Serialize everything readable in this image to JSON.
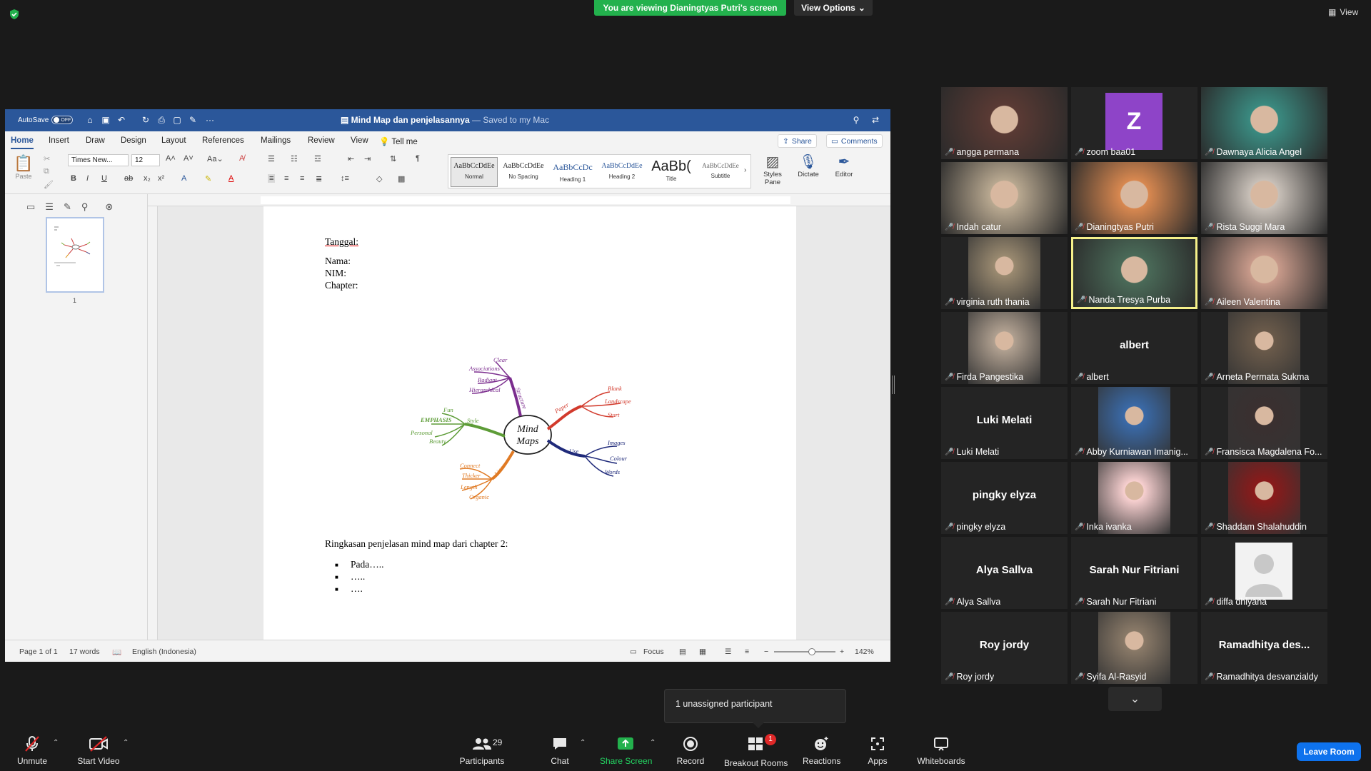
{
  "topbar": {
    "banner": "You are viewing Dianingtyas Putri's screen",
    "view_options": "View Options",
    "view": "View"
  },
  "word": {
    "autosave_label": "AutoSave",
    "autosave_state": "OFF",
    "doc_title": "Mind Map dan penjelasannya",
    "saved_status": "— Saved to my Mac",
    "tabs": [
      "Home",
      "Insert",
      "Draw",
      "Design",
      "Layout",
      "References",
      "Mailings",
      "Review",
      "View"
    ],
    "tell_me": "Tell me",
    "share": "Share",
    "comments": "Comments",
    "paste": "Paste",
    "font_name": "Times New...",
    "font_size": "12",
    "styles": [
      {
        "sample": "AaBbCcDdEe",
        "label": "Normal"
      },
      {
        "sample": "AaBbCcDdEe",
        "label": "No Spacing"
      },
      {
        "sample": "AaBbCcDc",
        "label": "Heading 1"
      },
      {
        "sample": "AaBbCcDdEe",
        "label": "Heading 2"
      },
      {
        "sample": "AaBb(",
        "label": "Title"
      },
      {
        "sample": "AaBbCcDdEe",
        "label": "Subtitle"
      }
    ],
    "styles_pane": "Styles Pane",
    "dictate": "Dictate",
    "editor": "Editor",
    "thumb_page": "1",
    "document": {
      "tanggal": "Tanggal:",
      "nama": "Nama:",
      "nim": "NIM:",
      "chapter": "Chapter:",
      "ringkasan": "Ringkasan penjelasan mind map dari chapter 2:",
      "bullets": [
        "Pada…..",
        "…..",
        "…."
      ],
      "mindmap": {
        "center": [
          "Mind",
          "Maps"
        ],
        "labels": [
          "Clear",
          "Associations",
          "Radiant",
          "Hierarchical",
          "Structure",
          "Paper",
          "Blank",
          "Landscape",
          "Start",
          "Use",
          "Images",
          "Colour",
          "Words",
          "Lines",
          "Connect",
          "Thicker",
          "Length",
          "Organic",
          "Style",
          "Fun",
          "EMPHASIS",
          "Personal",
          "Beauty"
        ]
      }
    },
    "status": {
      "page": "Page 1 of 1",
      "words": "17 words",
      "language": "English (Indonesia)",
      "focus": "Focus",
      "zoom": "142%"
    }
  },
  "participants": [
    {
      "name": "angga permana",
      "display": "video",
      "color": "#5a3a34"
    },
    {
      "name": "zoom baa01",
      "display": "letter",
      "letter": "Z",
      "color": "#8e44c8"
    },
    {
      "name": "Dawnaya Alicia Angel",
      "display": "video",
      "color": "#3a8a80"
    },
    {
      "name": "Indah catur",
      "display": "video",
      "color": "#b8a890"
    },
    {
      "name": "Dianingtyas Putri",
      "display": "video",
      "color": "#d88850"
    },
    {
      "name": "Rista Suggi Mara",
      "display": "video",
      "color": "#c8c0b8"
    },
    {
      "name": "virginia ruth thania",
      "display": "photo",
      "color": "#9a8a70"
    },
    {
      "name": "Nanda Tresya Purba",
      "display": "video",
      "color": "#4a6a58",
      "active": true
    },
    {
      "name": "Aileen Valentina",
      "display": "video",
      "color": "#c89a8a"
    },
    {
      "name": "Firda Pangestika",
      "display": "photo",
      "color": "#b0a090"
    },
    {
      "name": "albert",
      "display": "text"
    },
    {
      "name": "Arneta Permata Sukma",
      "display": "photo",
      "color": "#6a5a4a"
    },
    {
      "name": "Luki Melati",
      "display": "text"
    },
    {
      "name": "Abby Kurniawan Imanig...",
      "display": "photo",
      "color": "#3a6aa8"
    },
    {
      "name": "Fransisca Magdalena Fo...",
      "display": "photo",
      "color": "#3a3030"
    },
    {
      "name": "pingky elyza",
      "display": "text"
    },
    {
      "name": "Inka ivanka",
      "display": "photo",
      "color": "#f8d0d0"
    },
    {
      "name": "Shaddam Shalahuddin",
      "display": "photo",
      "color": "#8a1a1a"
    },
    {
      "name": "Alya Sallva",
      "display": "text"
    },
    {
      "name": "Sarah Nur Fitriani",
      "display": "text"
    },
    {
      "name": "diffa dhiyana",
      "display": "avatar"
    },
    {
      "name": "Roy jordy",
      "display": "text"
    },
    {
      "name": "Syifa Al-Rasyid",
      "display": "photo",
      "color": "#8a7a68"
    },
    {
      "name": "Ramadhitya desvanzialdy",
      "display": "text",
      "center": "Ramadhitya  des..."
    }
  ],
  "popup": {
    "unassigned": "1 unassigned participant"
  },
  "toolbar": {
    "unmute": "Unmute",
    "start_video": "Start Video",
    "participants": "Participants",
    "participants_count": "29",
    "chat": "Chat",
    "share_screen": "Share Screen",
    "record": "Record",
    "breakout": "Breakout Rooms",
    "breakout_badge": "1",
    "reactions": "Reactions",
    "apps": "Apps",
    "whiteboards": "Whiteboards",
    "leave": "Leave Room"
  }
}
